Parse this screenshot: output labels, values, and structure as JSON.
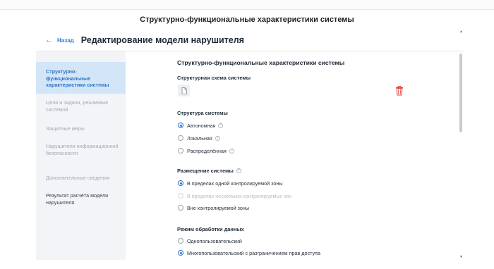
{
  "window": {
    "title": "Структурно-функциональные характеристики системы"
  },
  "header": {
    "back_label": "Назад",
    "title": "Редактирование модели нарушителя"
  },
  "sidebar": {
    "items": [
      {
        "label": "Структурно-функциональные характеристики системы",
        "state": "active"
      },
      {
        "label": "Цели и задачи, решаемые системой",
        "state": "muted"
      },
      {
        "label": "Защитные меры",
        "state": "muted"
      },
      {
        "label": "Нарушители информационной безопасности",
        "state": "muted"
      },
      {
        "label": "Дополнительные сведения",
        "state": "muted"
      },
      {
        "label": "Результат расчёта модели нарушителя",
        "state": "normal"
      }
    ]
  },
  "main": {
    "heading": "Структурно-функциональные характеристики системы",
    "schema_label": "Структурная схема системы",
    "structure": {
      "label": "Структура системы",
      "options": [
        {
          "label": "Автономная",
          "checked": true,
          "help": true
        },
        {
          "label": "Локальная",
          "checked": false,
          "help": true
        },
        {
          "label": "Распределённая",
          "checked": false,
          "help": true
        }
      ]
    },
    "placement": {
      "label": "Размещение системы",
      "options": [
        {
          "label": "В пределах одной контролируемой зоны",
          "checked": true,
          "disabled": false
        },
        {
          "label": "В пределах нескольких контролируемых зон",
          "checked": false,
          "disabled": true
        },
        {
          "label": "Вне контролируемой зоны",
          "checked": false,
          "disabled": false
        }
      ]
    },
    "processing": {
      "label": "Режим обработки данных",
      "options": [
        {
          "label": "Однопользовательский",
          "checked": false
        },
        {
          "label": "Многопользовательский с разграничением прав доступа",
          "checked": true
        }
      ]
    }
  },
  "colors": {
    "accent": "#2f74c4",
    "link": "#2f7fd6",
    "sidebar_bg": "#f2f4f7",
    "active_bg": "#d3e6f8",
    "danger": "#e0403a"
  },
  "icons": {
    "back": "arrow-left-icon",
    "file": "file-icon",
    "delete": "trash-icon",
    "help": "question-circle-icon"
  }
}
